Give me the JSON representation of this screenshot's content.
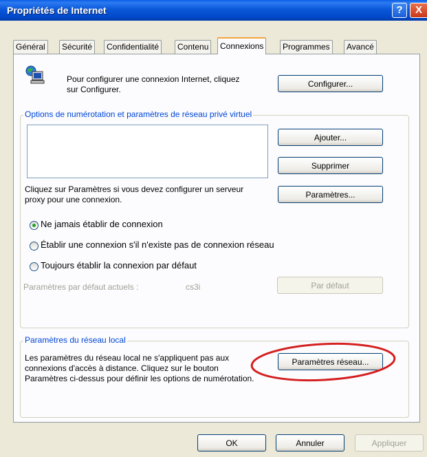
{
  "window": {
    "title": "Propriétés de Internet"
  },
  "titlebar_buttons": {
    "help": "?",
    "close": "X"
  },
  "tabs": [
    {
      "label": "Général"
    },
    {
      "label": "Sécurité"
    },
    {
      "label": "Confidentialité"
    },
    {
      "label": "Contenu"
    },
    {
      "label": "Connexions"
    },
    {
      "label": "Programmes"
    },
    {
      "label": "Avancé"
    }
  ],
  "connections": {
    "intro_text": "Pour configurer une connexion Internet, cliquez sur Configurer.",
    "configure_button": "Configurer...",
    "dialup_group_label": "Options de numérotation et paramètres de réseau privé virtuel",
    "add_button": "Ajouter...",
    "remove_button": "Supprimer",
    "proxy_text": "Cliquez sur Paramètres si vous devez configurer un serveur proxy pour une connexion.",
    "settings_button": "Paramètres...",
    "radios": [
      {
        "label": "Ne jamais établir de connexion",
        "selected": true
      },
      {
        "label": "Établir une connexion s'il n'existe pas de connexion réseau",
        "selected": false
      },
      {
        "label": "Toujours établir la connexion par défaut",
        "selected": false
      }
    ],
    "default_label": "Paramètres par défaut actuels :",
    "default_value": "cs3i",
    "default_button": "Par défaut",
    "lan_group_label": "Paramètres du réseau local",
    "lan_text": "Les paramètres du réseau local ne s'appliquent pas aux connexions d'accès à distance. Cliquez sur le bouton Paramètres ci-dessus pour définir les options de numérotation.",
    "lan_button": "Paramètres réseau..."
  },
  "footer": {
    "ok": "OK",
    "cancel": "Annuler",
    "apply": "Appliquer"
  },
  "colors": {
    "titlebar": "#0a58d8",
    "legend_text": "#0046d5",
    "highlight_ellipse": "#d42020",
    "active_tab_accent": "#f5a33b"
  }
}
